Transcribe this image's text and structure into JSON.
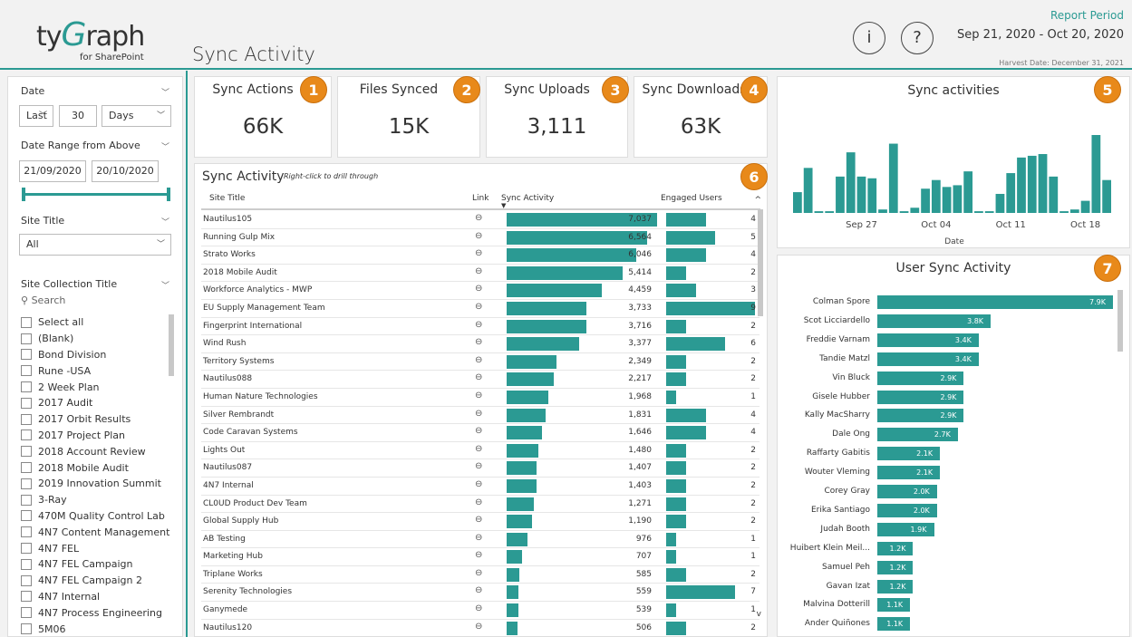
{
  "header": {
    "logo_main_pre": "ty",
    "logo_main_g": "G",
    "logo_main_post": "raph",
    "logo_sub": "for SharePoint",
    "page_title": "Sync Activity",
    "info_glyph": "i",
    "help_glyph": "?",
    "report_period_label": "Report Period",
    "report_period_range": "Sep 21, 2020 - Oct 20, 2020",
    "harvest_date": "Harvest Date: December 31, 2021"
  },
  "sidebar": {
    "date_label": "Date",
    "relative_mode": "Last",
    "relative_count": "30",
    "relative_unit": "Days",
    "date_range_label": "Date Range from Above",
    "start_date": "21/09/2020",
    "end_date": "20/10/2020",
    "site_title_label": "Site Title",
    "site_title_value": "All",
    "site_collection_label": "Site Collection Title",
    "search_placeholder": "Search",
    "items": [
      "Select all",
      "(Blank)",
      "Bond Division",
      "Rune -USA",
      "2 Week Plan",
      "2017 Audit",
      "2017 Orbit Results",
      "2017 Project Plan",
      "2018 Account Review",
      "2018 Mobile Audit",
      "2019 Innovation Summit",
      "3-Ray",
      "470M Quality Control Lab",
      "4N7 Content Management",
      "4N7 FEL",
      "4N7 FEL Campaign",
      "4N7 FEL Campaign 2",
      "4N7 Internal",
      "4N7 Process Engineering",
      "5M06"
    ]
  },
  "kpis": [
    {
      "title": "Sync Actions",
      "value": "66K",
      "badge": "1"
    },
    {
      "title": "Files Synced",
      "value": "15K",
      "badge": "2"
    },
    {
      "title": "Sync Uploads",
      "value": "3,111",
      "badge": "3"
    },
    {
      "title": "Sync Downloads",
      "value": "63K",
      "badge": "4"
    }
  ],
  "table": {
    "title": "Sync Activity",
    "hint": "Right-click to drill through",
    "badge": "6",
    "col_site": "Site Title",
    "col_link": "Link",
    "col_sync": "Sync Activity",
    "col_users": "Engaged Users",
    "link_glyph": "⊖",
    "sort_arrow": "▼",
    "scroll_up": "^",
    "scroll_down": "v",
    "max_sync": 7037,
    "max_users": 9,
    "rows": [
      {
        "site": "Nautilus105",
        "sync": 7037,
        "sync_label": "7,037",
        "users": 4
      },
      {
        "site": "Running Gulp Mix",
        "sync": 6564,
        "sync_label": "6,564",
        "users": 5
      },
      {
        "site": "Strato Works",
        "sync": 6046,
        "sync_label": "6,046",
        "users": 4
      },
      {
        "site": "2018 Mobile Audit",
        "sync": 5414,
        "sync_label": "5,414",
        "users": 2
      },
      {
        "site": "Workforce Analytics - MWP",
        "sync": 4459,
        "sync_label": "4,459",
        "users": 3
      },
      {
        "site": "EU Supply Management Team",
        "sync": 3733,
        "sync_label": "3,733",
        "users": 9
      },
      {
        "site": "Fingerprint International",
        "sync": 3716,
        "sync_label": "3,716",
        "users": 2
      },
      {
        "site": "Wind Rush",
        "sync": 3377,
        "sync_label": "3,377",
        "users": 6
      },
      {
        "site": "Territory Systems",
        "sync": 2349,
        "sync_label": "2,349",
        "users": 2
      },
      {
        "site": "Nautilus088",
        "sync": 2217,
        "sync_label": "2,217",
        "users": 2
      },
      {
        "site": "Human Nature Technologies",
        "sync": 1968,
        "sync_label": "1,968",
        "users": 1
      },
      {
        "site": "Silver Rembrandt",
        "sync": 1831,
        "sync_label": "1,831",
        "users": 4
      },
      {
        "site": "Code Caravan Systems",
        "sync": 1646,
        "sync_label": "1,646",
        "users": 4
      },
      {
        "site": "Lights Out",
        "sync": 1480,
        "sync_label": "1,480",
        "users": 2
      },
      {
        "site": "Nautilus087",
        "sync": 1407,
        "sync_label": "1,407",
        "users": 2
      },
      {
        "site": "4N7 Internal",
        "sync": 1403,
        "sync_label": "1,403",
        "users": 2
      },
      {
        "site": "CL0UD Product Dev Team",
        "sync": 1271,
        "sync_label": "1,271",
        "users": 2
      },
      {
        "site": "Global Supply Hub",
        "sync": 1190,
        "sync_label": "1,190",
        "users": 2
      },
      {
        "site": "AB Testing",
        "sync": 976,
        "sync_label": "976",
        "users": 1
      },
      {
        "site": "Marketing Hub",
        "sync": 707,
        "sync_label": "707",
        "users": 1
      },
      {
        "site": "Triplane Works",
        "sync": 585,
        "sync_label": "585",
        "users": 2
      },
      {
        "site": "Serenity Technologies",
        "sync": 559,
        "sync_label": "559",
        "users": 7
      },
      {
        "site": "Ganymede",
        "sync": 539,
        "sync_label": "539",
        "users": 1
      },
      {
        "site": "Nautilus120",
        "sync": 506,
        "sync_label": "506",
        "users": 2
      }
    ]
  },
  "sync_chart": {
    "badge": "5",
    "title_text": "Sync activities",
    "xlabel_text": "Date",
    "tick_labels": [
      "Sep 27",
      "Oct 04",
      "Oct 11",
      "Oct 18"
    ]
  },
  "user_chart": {
    "badge": "7",
    "title_text": "User Sync Activity"
  },
  "chart_data": [
    {
      "type": "bar",
      "title": "Sync activities",
      "xlabel": "Date",
      "ylabel": "",
      "categories": [
        "Sep 21",
        "Sep 22",
        "Sep 23",
        "Sep 24",
        "Sep 25",
        "Sep 26",
        "Sep 27",
        "Sep 28",
        "Sep 29",
        "Sep 30",
        "Oct 01",
        "Oct 02",
        "Oct 03",
        "Oct 04",
        "Oct 05",
        "Oct 06",
        "Oct 07",
        "Oct 08",
        "Oct 09",
        "Oct 10",
        "Oct 11",
        "Oct 12",
        "Oct 13",
        "Oct 14",
        "Oct 15",
        "Oct 16",
        "Oct 17",
        "Oct 18",
        "Oct 19",
        "Oct 20"
      ],
      "values": [
        1.2,
        2.6,
        0.1,
        0.1,
        2.1,
        3.5,
        2.1,
        2.0,
        0.2,
        4.0,
        0.1,
        0.3,
        1.4,
        1.9,
        1.5,
        1.6,
        2.4,
        0.1,
        0.1,
        1.1,
        2.3,
        3.2,
        3.3,
        3.4,
        2.1,
        0.1,
        0.2,
        0.7,
        4.5,
        1.9
      ],
      "xticks": [
        "Sep 27",
        "Oct 04",
        "Oct 11",
        "Oct 18"
      ]
    },
    {
      "type": "bar",
      "title": "User Sync Activity",
      "orientation": "horizontal",
      "categories": [
        "Colman Spore",
        "Scot Licciardello",
        "Freddie Varnam",
        "Tandie Matzl",
        "Vin Bluck",
        "Gisele Hubber",
        "Kally MacSharry",
        "Dale Ong",
        "Raffarty Gabitis",
        "Wouter Vleming",
        "Corey Gray",
        "Erika Santiago",
        "Judah Booth",
        "Huibert Klein Meil...",
        "Samuel Peh",
        "Gavan Izat",
        "Malvina Dotterill",
        "Ander Quiñones"
      ],
      "values": [
        7.9,
        3.8,
        3.4,
        3.4,
        2.9,
        2.9,
        2.9,
        2.7,
        2.1,
        2.1,
        2.0,
        2.0,
        1.9,
        1.2,
        1.2,
        1.2,
        1.1,
        1.1
      ],
      "labels": [
        "7.9K",
        "3.8K",
        "3.4K",
        "3.4K",
        "2.9K",
        "2.9K",
        "2.9K",
        "2.7K",
        "2.1K",
        "2.1K",
        "2.0K",
        "2.0K",
        "1.9K",
        "1.2K",
        "1.2K",
        "1.2K",
        "1.1K",
        "1.1K"
      ]
    }
  ],
  "colors": {
    "accent": "#2b9a93",
    "badge": "#e8891a"
  }
}
